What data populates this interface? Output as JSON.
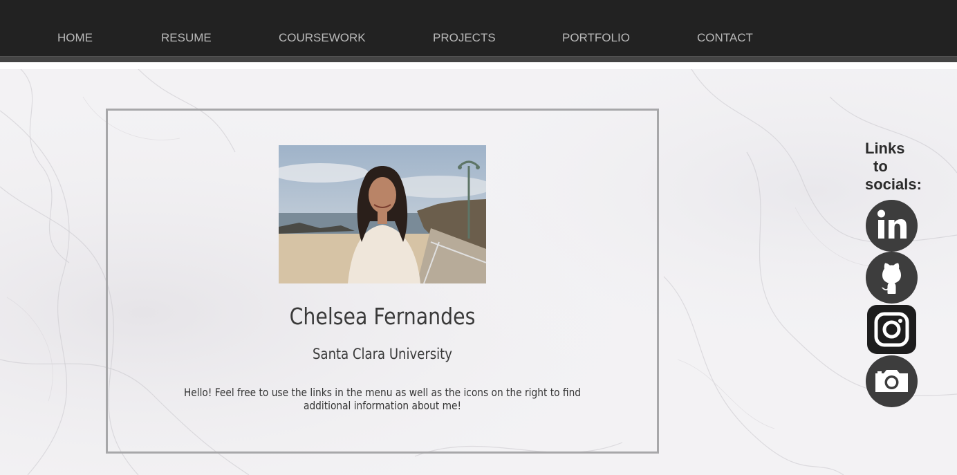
{
  "nav": {
    "items": [
      {
        "label": "HOME"
      },
      {
        "label": "RESUME"
      },
      {
        "label": "COURSEWORK"
      },
      {
        "label": "PROJECTS"
      },
      {
        "label": "PORTFOLIO"
      },
      {
        "label": "CONTACT"
      }
    ]
  },
  "profile": {
    "name": "Chelsea Fernandes",
    "school": "Santa Clara University",
    "intro": "Hello! Feel free to use the links in the menu as well as the icons on the right to find additional information about me!"
  },
  "socials": {
    "title_line1": "Links",
    "title_line2": "to",
    "title_line3": "socials:",
    "icons": [
      "linkedin-icon",
      "github-icon",
      "instagram-icon",
      "camera-icon"
    ]
  },
  "colors": {
    "header_bg": "#222222",
    "nav_text": "#b9b9b9",
    "icon_dark": "#3d3d3d",
    "card_border": "#a7a7a9"
  }
}
